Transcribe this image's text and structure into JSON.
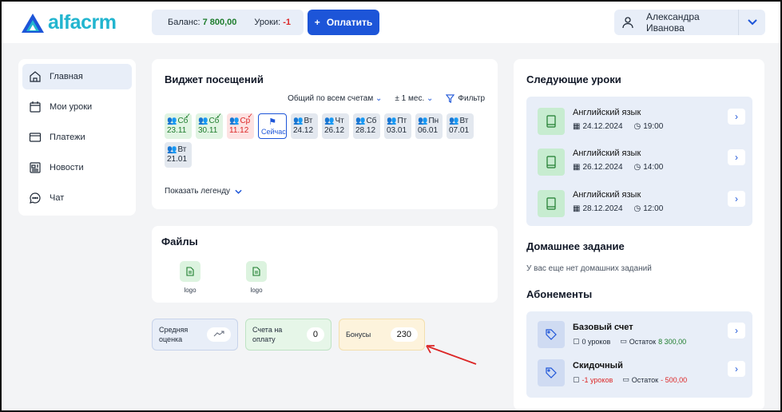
{
  "header": {
    "logo_text": "alfacrm",
    "balance_label": "Баланс:",
    "balance_value": "7 800,00",
    "lessons_label": "Уроки:",
    "lessons_value": "-1",
    "pay_label": "Оплатить",
    "user_name": "Александра Иванова"
  },
  "sidebar": {
    "items": [
      {
        "label": "Главная",
        "icon": "home-icon"
      },
      {
        "label": "Мои уроки",
        "icon": "calendar-icon"
      },
      {
        "label": "Платежи",
        "icon": "card-icon"
      },
      {
        "label": "Новости",
        "icon": "news-icon"
      },
      {
        "label": "Чат",
        "icon": "chat-icon"
      }
    ]
  },
  "visits": {
    "title": "Виджет посещений",
    "filter_account": "Общий по всем счетам",
    "filter_period": "± 1 мес.",
    "filter_label": "Фильтр",
    "days": [
      {
        "dow": "Сб",
        "date": "23.11",
        "status": "attended"
      },
      {
        "dow": "Сб",
        "date": "30.11",
        "status": "attended"
      },
      {
        "dow": "Ср",
        "date": "11.12",
        "status": "missed"
      },
      {
        "dow": "Сейчас",
        "date": "",
        "status": "now"
      },
      {
        "dow": "Вт",
        "date": "24.12",
        "status": "planned"
      },
      {
        "dow": "Чт",
        "date": "26.12",
        "status": "planned"
      },
      {
        "dow": "Сб",
        "date": "28.12",
        "status": "planned"
      },
      {
        "dow": "Пт",
        "date": "03.01",
        "status": "planned"
      },
      {
        "dow": "Пн",
        "date": "06.01",
        "status": "planned"
      },
      {
        "dow": "Вт",
        "date": "07.01",
        "status": "planned"
      },
      {
        "dow": "Вт",
        "date": "21.01",
        "status": "planned"
      }
    ],
    "legend_link": "Показать легенду"
  },
  "files": {
    "title": "Файлы",
    "items": [
      {
        "name": "logo"
      },
      {
        "name": "logo"
      }
    ]
  },
  "stats": {
    "avg_label": "Средняя оценка",
    "invoices_label": "Счета на оплату",
    "invoices_value": "0",
    "bonus_label": "Бонусы",
    "bonus_value": "230"
  },
  "next_lessons": {
    "title": "Следующие уроки",
    "items": [
      {
        "name": "Английский язык",
        "date": "24.12.2024",
        "time": "19:00"
      },
      {
        "name": "Английский язык",
        "date": "26.12.2024",
        "time": "14:00"
      },
      {
        "name": "Английский язык",
        "date": "28.12.2024",
        "time": "12:00"
      }
    ]
  },
  "homework": {
    "title": "Домашнее задание",
    "empty_text": "У вас еще нет домашних заданий"
  },
  "subscriptions": {
    "title": "Абонементы",
    "items": [
      {
        "name": "Базовый счет",
        "lessons": "0 уроков",
        "rest_label": "Остаток",
        "rest_value": "8 300,00",
        "lessons_color": "#1f2937",
        "rest_color": "#1d7c2c"
      },
      {
        "name": "Скидочный",
        "lessons": "-1 уроков",
        "rest_label": "Остаток",
        "rest_value": "- 500,00",
        "lessons_color": "#dc2626",
        "rest_color": "#dc2626"
      }
    ]
  }
}
